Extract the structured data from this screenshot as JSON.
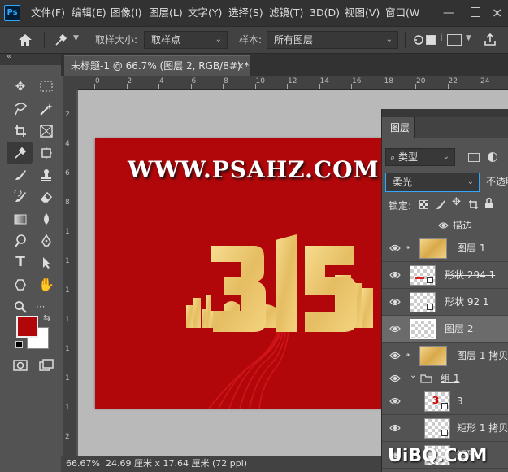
{
  "app": {
    "logo": "Ps"
  },
  "menu": [
    "文件(F)",
    "编辑(E)",
    "图像(I)",
    "图层(L)",
    "文字(Y)",
    "选择(S)",
    "滤镜(T)",
    "3D(D)",
    "视图(V)",
    "窗口(W"
  ],
  "options": {
    "sample_size_label": "取样大小:",
    "sample_size_value": "取样点",
    "sample_label": "样本:",
    "sample_value": "所有图层"
  },
  "document": {
    "tab_title": "未标题-1 @ 66.7% (图层 2, RGB/8#) *",
    "close": "×",
    "url_text": "WWW.PSAHZ.COM",
    "big_number": "315"
  },
  "ruler": {
    "h": [
      "0",
      "2",
      "4",
      "6",
      "8",
      "10",
      "12",
      "14",
      "16",
      "18",
      "20",
      "22",
      "24",
      "2"
    ],
    "v": [
      "2",
      "4",
      "6",
      "8",
      "1",
      "1",
      "1",
      "1",
      "1",
      "1",
      "1",
      "2"
    ]
  },
  "status": {
    "zoom": "66.67%",
    "info": "24.69 厘米 x 17.64 厘米 (72 ppi)"
  },
  "layers": {
    "tab": "图层",
    "filter_kind": "类型",
    "blend_mode": "柔光",
    "opacity_label": "不透明",
    "lock_label": "锁定:",
    "stroke_label": "描边",
    "rows": [
      {
        "name": "图层 1",
        "thumb": "gold",
        "clip": true,
        "selected": false
      },
      {
        "name": "形状 294 1",
        "thumb": "shape",
        "clip": false,
        "selected": false
      },
      {
        "name": "形状 92 1",
        "thumb": "shape",
        "clip": false,
        "selected": false
      },
      {
        "name": "图层 2",
        "thumb": "trans",
        "clip": false,
        "selected": true
      },
      {
        "name": "图层 1 拷贝",
        "thumb": "gold",
        "clip": true,
        "selected": false
      },
      {
        "name": "组 1",
        "thumb": "folder",
        "clip": false,
        "selected": false
      },
      {
        "name": "3",
        "thumb": "shape",
        "clip": false,
        "selected": false
      },
      {
        "name": "矩形 1 拷贝",
        "thumb": "shape",
        "clip": false,
        "selected": false
      },
      {
        "name": "矩形",
        "thumb": "shape",
        "clip": false,
        "selected": false
      }
    ]
  },
  "colors": {
    "foreground": "#b2070a",
    "background": "#ffffff",
    "accent": "#31a8ff"
  },
  "watermark": "UiBQ.CoM"
}
